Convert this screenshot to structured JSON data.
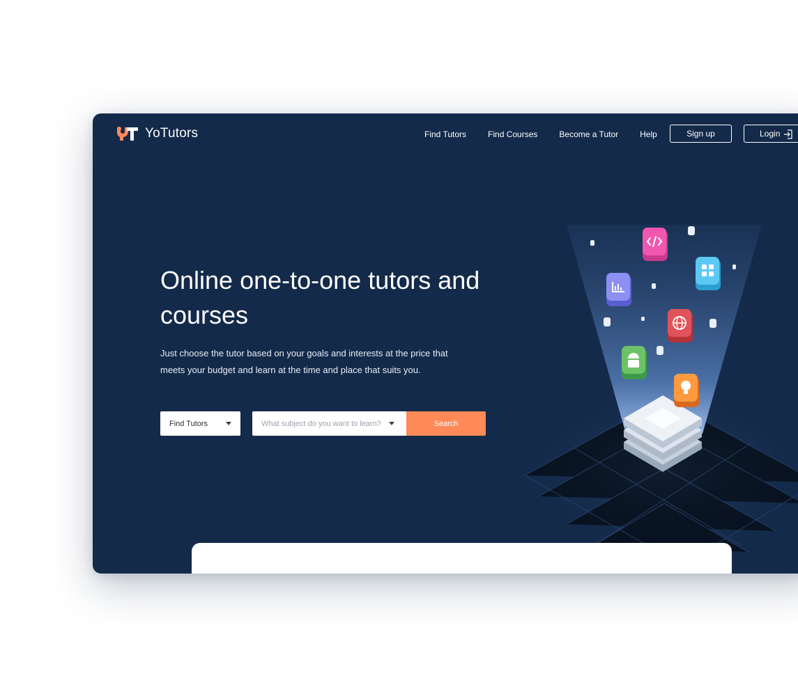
{
  "brand": {
    "name": "YoTutors",
    "logo_icon": "yt-logo-mark",
    "accent": "#ff8a57",
    "background": "#142a4a"
  },
  "nav": {
    "items": [
      {
        "label": "Find Tutors"
      },
      {
        "label": "Find Courses"
      },
      {
        "label": "Become a Tutor"
      },
      {
        "label": "Help"
      }
    ]
  },
  "auth": {
    "signup_label": "Sign up",
    "login_label": "Login",
    "login_icon": "login-arrow-icon"
  },
  "hero": {
    "title": "Online one-to-one tutors and courses",
    "subtitle": "Just choose the tutor based on your goals and interests at the price that meets your budget and learn at the time and place that suits you."
  },
  "search": {
    "type_selected": "Find Tutors",
    "placeholder": "What subject do you want to learn?",
    "button_label": "Search"
  },
  "illustration": {
    "icons": [
      "code-icon",
      "chart-icon",
      "globe-icon",
      "grid-icon",
      "android-icon",
      "lightbulb-icon",
      "layered-stack-icon"
    ]
  }
}
